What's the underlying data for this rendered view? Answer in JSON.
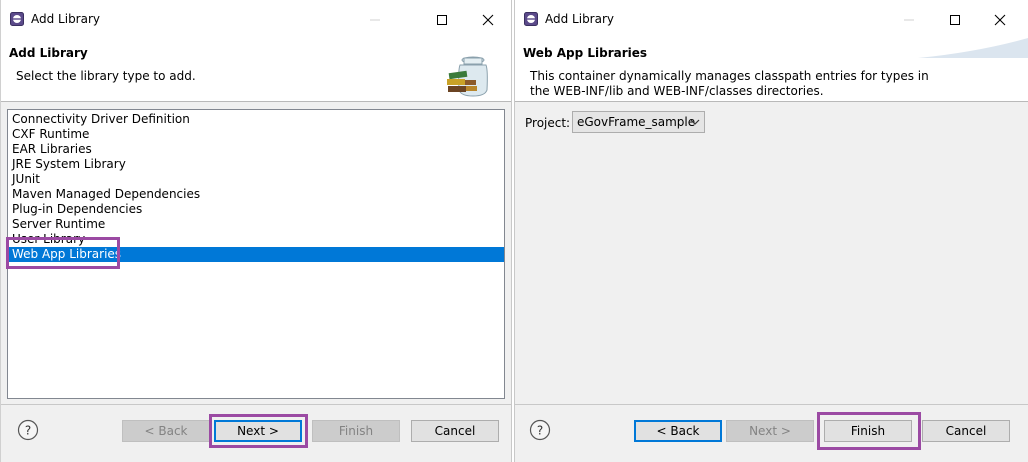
{
  "left_dialog": {
    "title": "Add Library",
    "header_title": "Add Library",
    "header_message": "Select the library type to add.",
    "library_types": [
      "Connectivity Driver Definition",
      "CXF Runtime",
      "EAR Libraries",
      "JRE System Library",
      "JUnit",
      "Maven Managed Dependencies",
      "Plug-in Dependencies",
      "Server Runtime",
      "User Library",
      "Web App Libraries"
    ],
    "selected_index": 9,
    "buttons": {
      "back": "< Back",
      "next": "Next >",
      "finish": "Finish",
      "cancel": "Cancel"
    }
  },
  "right_dialog": {
    "title": "Add Library",
    "header_title": "Web App Libraries",
    "header_message_line1": "This container dynamically manages classpath entries for types in",
    "header_message_line2": "the WEB-INF/lib and WEB-INF/classes directories.",
    "project_label": "Project:",
    "project_value": "eGovFrame_sample",
    "buttons": {
      "back": "< Back",
      "next": "Next >",
      "finish": "Finish",
      "cancel": "Cancel"
    }
  },
  "colors": {
    "selection": "#0078d7",
    "highlight_annotation": "#9b4aa3"
  },
  "icons": [
    "eclipse-app-icon",
    "minimize-icon",
    "maximize-icon",
    "close-icon",
    "help-icon",
    "library-jar-banner-icon",
    "dropdown-arrow-icon"
  ]
}
